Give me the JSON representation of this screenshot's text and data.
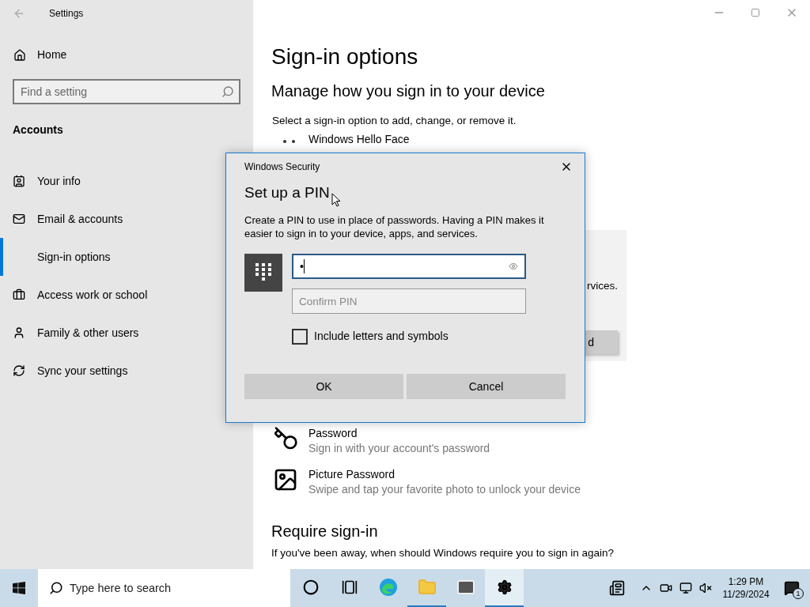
{
  "window": {
    "title": "Settings"
  },
  "sidebar": {
    "home": "Home",
    "search": {
      "placeholder": "Find a setting"
    },
    "section": "Accounts",
    "items": [
      {
        "label": "Your info",
        "selected": false
      },
      {
        "label": "Email & accounts",
        "selected": false
      },
      {
        "label": "Sign-in options",
        "selected": true
      },
      {
        "label": "Access work or school",
        "selected": false
      },
      {
        "label": "Family & other users",
        "selected": false
      },
      {
        "label": "Sync your settings",
        "selected": false
      }
    ]
  },
  "main": {
    "title": "Sign-in options",
    "heading": "Manage how you sign in to your device",
    "intro": "Select a sign-in option to add, change, or remove it.",
    "options": [
      {
        "title": "Windows Hello Face"
      },
      {
        "title": "Password",
        "description": "Sign in with your account's password"
      },
      {
        "title": "Picture Password",
        "description": "Swipe and tap your favorite photo to unlock your device"
      }
    ],
    "hidden_panel": {
      "text": "rvices.",
      "button": "d"
    },
    "section_title": "Require sign-in",
    "section_text": "If you've been away, when should Windows require you to sign in again?"
  },
  "dialog": {
    "caption": "Windows Security",
    "title": "Set up a PIN",
    "description": "Create a PIN to use in place of passwords. Having a PIN makes it easier to sign in to your device, apps, and services.",
    "pin_field": {
      "value": "•"
    },
    "confirm_field": {
      "placeholder": "Confirm PIN"
    },
    "checkbox": {
      "label": "Include letters and symbols",
      "checked": false
    },
    "buttons": [
      "OK",
      "Cancel"
    ]
  },
  "taskbar": {
    "search": {
      "placeholder": "Type here to search"
    },
    "apps": [
      {
        "running": false,
        "selected": false
      },
      {
        "running": false,
        "selected": false
      },
      {
        "running": false,
        "selected": false
      },
      {
        "running": true,
        "selected": false
      },
      {
        "running": false,
        "selected": false
      },
      {
        "running": true,
        "selected": true
      }
    ],
    "time": "1:29 PM",
    "date": "11/29/2024",
    "notification_count": "1"
  }
}
